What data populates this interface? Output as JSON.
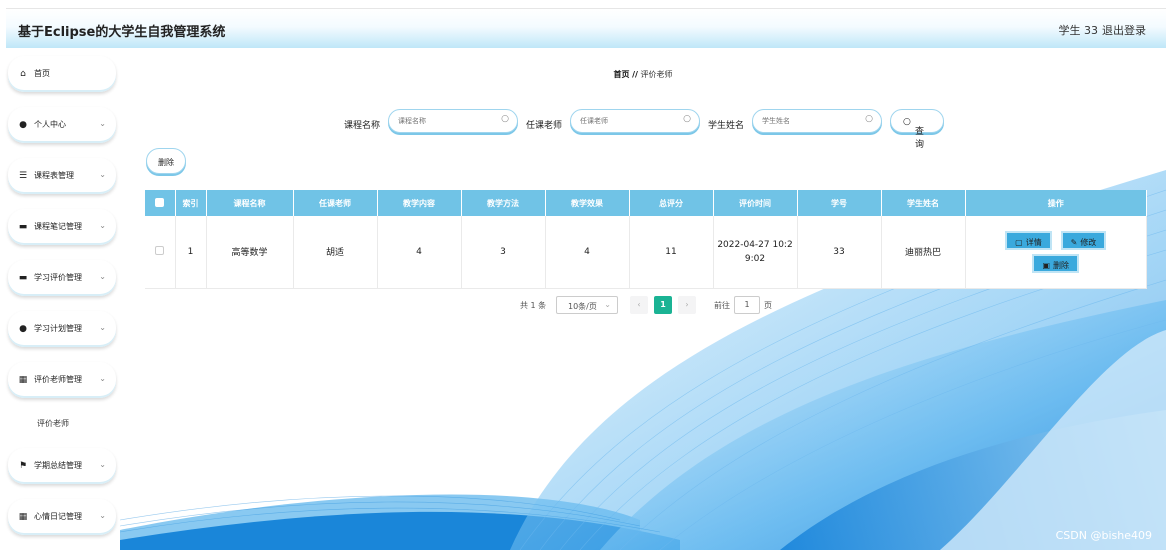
{
  "header": {
    "title": "基于Eclipse的大学生自我管理系统",
    "user": "学生 33",
    "logout": "退出登录"
  },
  "sidebar": {
    "items": [
      {
        "label": "首页",
        "icon": "home-icon",
        "glyph": "⌂",
        "has_chevron": false
      },
      {
        "label": "个人中心",
        "icon": "user-icon",
        "glyph": "●",
        "has_chevron": true
      },
      {
        "label": "课程表管理",
        "icon": "list-icon",
        "glyph": "☰",
        "has_chevron": true
      },
      {
        "label": "课程笔记管理",
        "icon": "folder-icon",
        "glyph": "▬",
        "has_chevron": true
      },
      {
        "label": "学习评价管理",
        "icon": "monitor-icon",
        "glyph": "▬",
        "has_chevron": true
      },
      {
        "label": "学习计划管理",
        "icon": "user-icon",
        "glyph": "●",
        "has_chevron": true
      },
      {
        "label": "评价老师管理",
        "icon": "grid-icon",
        "glyph": "▦",
        "has_chevron": true
      },
      {
        "label": "学期总结管理",
        "icon": "flag-icon",
        "glyph": "⚑",
        "has_chevron": true
      },
      {
        "label": "心情日记管理",
        "icon": "grid-icon",
        "glyph": "▦",
        "has_chevron": true
      }
    ],
    "subitem": "评价老师",
    "chevron": "⌄"
  },
  "breadcrumb": {
    "home": "首页",
    "separator": "//",
    "current": "评价老师"
  },
  "search": {
    "course_label": "课程名称",
    "course_placeholder": "课程名称",
    "teacher_label": "任课老师",
    "teacher_placeholder": "任课老师",
    "student_label": "学生姓名",
    "student_placeholder": "学生姓名",
    "query_button": "查询"
  },
  "toolbar": {
    "delete_label": "删除"
  },
  "table": {
    "columns": [
      "索引",
      "课程名称",
      "任课老师",
      "教学内容",
      "教学方法",
      "教学效果",
      "总评分",
      "评价时间",
      "学号",
      "学生姓名",
      "操作"
    ],
    "rows": [
      {
        "index": "1",
        "course": "高等数学",
        "teacher": "胡适",
        "content": "4",
        "method": "3",
        "effect": "4",
        "total": "11",
        "time_line1": "2022-04-27 10:2",
        "time_line2": "9:02",
        "student_no": "33",
        "student_name": "迪丽热巴"
      }
    ],
    "actions": {
      "detail": "详情",
      "edit": "修改",
      "delete": "删除"
    }
  },
  "pagination": {
    "total": "共 1 条",
    "page_size": "10条/页",
    "current_page": "1",
    "goto_label": "前往",
    "goto_value": "1",
    "page_unit": "页"
  },
  "watermark": "CSDN @bishe409",
  "colors": {
    "header_accent": "#bfe7f8",
    "table_header": "#70c3e6",
    "action_button": "#3aa9dd",
    "active_page": "#1ab394"
  }
}
